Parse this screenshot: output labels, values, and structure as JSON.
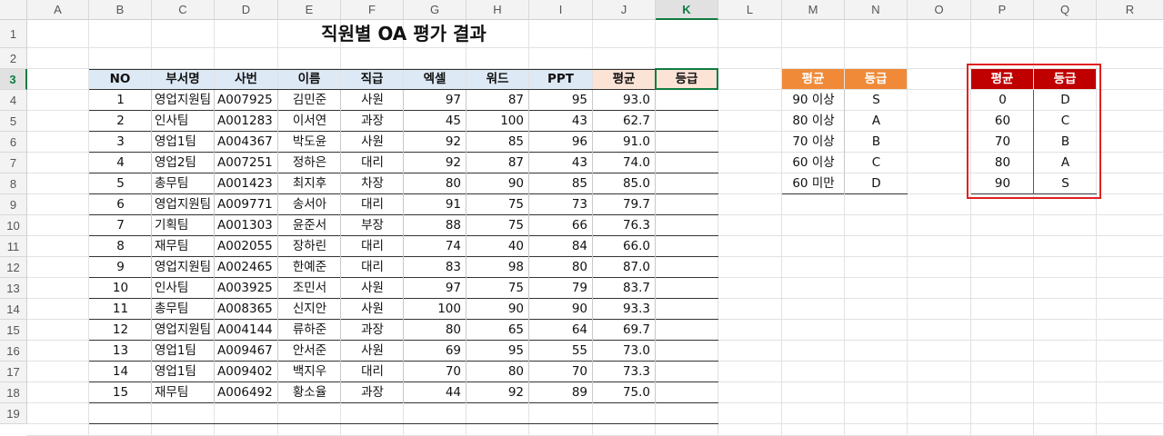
{
  "columns": [
    "A",
    "B",
    "C",
    "D",
    "E",
    "F",
    "G",
    "H",
    "I",
    "J",
    "K",
    "L",
    "M",
    "N",
    "O",
    "P",
    "Q",
    "R"
  ],
  "rows": [
    "1",
    "2",
    "3",
    "4",
    "5",
    "6",
    "7",
    "8",
    "9",
    "10",
    "11",
    "12",
    "13",
    "14",
    "15",
    "16",
    "17",
    "18",
    "19"
  ],
  "selected_cell": "K3",
  "title": "직원별 OA 평가 결과",
  "table": {
    "headers": [
      "NO",
      "부서명",
      "사번",
      "이름",
      "직급",
      "엑셀",
      "워드",
      "PPT",
      "평균",
      "등급"
    ],
    "rows": [
      [
        "1",
        "영업지원팀",
        "A007925",
        "김민준",
        "사원",
        "97",
        "87",
        "95",
        "93.0",
        ""
      ],
      [
        "2",
        "인사팀",
        "A001283",
        "이서연",
        "과장",
        "45",
        "100",
        "43",
        "62.7",
        ""
      ],
      [
        "3",
        "영업1팀",
        "A004367",
        "박도윤",
        "사원",
        "92",
        "85",
        "96",
        "91.0",
        ""
      ],
      [
        "4",
        "영업2팀",
        "A007251",
        "정하은",
        "대리",
        "92",
        "87",
        "43",
        "74.0",
        ""
      ],
      [
        "5",
        "총무팀",
        "A001423",
        "최지후",
        "차장",
        "80",
        "90",
        "85",
        "85.0",
        ""
      ],
      [
        "6",
        "영업지원팀",
        "A009771",
        "송서아",
        "대리",
        "91",
        "75",
        "73",
        "79.7",
        ""
      ],
      [
        "7",
        "기획팀",
        "A001303",
        "윤준서",
        "부장",
        "88",
        "75",
        "66",
        "76.3",
        ""
      ],
      [
        "8",
        "재무팀",
        "A002055",
        "장하린",
        "대리",
        "74",
        "40",
        "84",
        "66.0",
        ""
      ],
      [
        "9",
        "영업지원팀",
        "A002465",
        "한예준",
        "대리",
        "83",
        "98",
        "80",
        "87.0",
        ""
      ],
      [
        "10",
        "인사팀",
        "A003925",
        "조민서",
        "사원",
        "97",
        "75",
        "79",
        "83.7",
        ""
      ],
      [
        "11",
        "총무팀",
        "A008365",
        "신지안",
        "사원",
        "100",
        "90",
        "90",
        "93.3",
        ""
      ],
      [
        "12",
        "영업지원팀",
        "A004144",
        "류하준",
        "과장",
        "80",
        "65",
        "64",
        "69.7",
        ""
      ],
      [
        "13",
        "영업1팀",
        "A009467",
        "안서준",
        "사원",
        "69",
        "95",
        "55",
        "73.0",
        ""
      ],
      [
        "14",
        "영업1팀",
        "A009402",
        "백지우",
        "대리",
        "70",
        "80",
        "70",
        "73.3",
        ""
      ],
      [
        "15",
        "재무팀",
        "A006492",
        "황소율",
        "과장",
        "44",
        "92",
        "89",
        "75.0",
        ""
      ]
    ]
  },
  "criteria_table": {
    "headers": [
      "평균",
      "등급"
    ],
    "rows": [
      [
        "90 이상",
        "S"
      ],
      [
        "80 이상",
        "A"
      ],
      [
        "70 이상",
        "B"
      ],
      [
        "60 이상",
        "C"
      ],
      [
        "60 미만",
        "D"
      ]
    ]
  },
  "lookup_table": {
    "headers": [
      "평균",
      "등급"
    ],
    "rows": [
      [
        "0",
        "D"
      ],
      [
        "60",
        "C"
      ],
      [
        "70",
        "B"
      ],
      [
        "80",
        "A"
      ],
      [
        "90",
        "S"
      ]
    ]
  },
  "colors": {
    "header_blue": "#dde9f5",
    "header_peach": "#fbe3d6",
    "header_orange": "#f08a38",
    "header_red": "#c00000",
    "selection_green": "#107c41",
    "highlight_box": "#e02020"
  }
}
